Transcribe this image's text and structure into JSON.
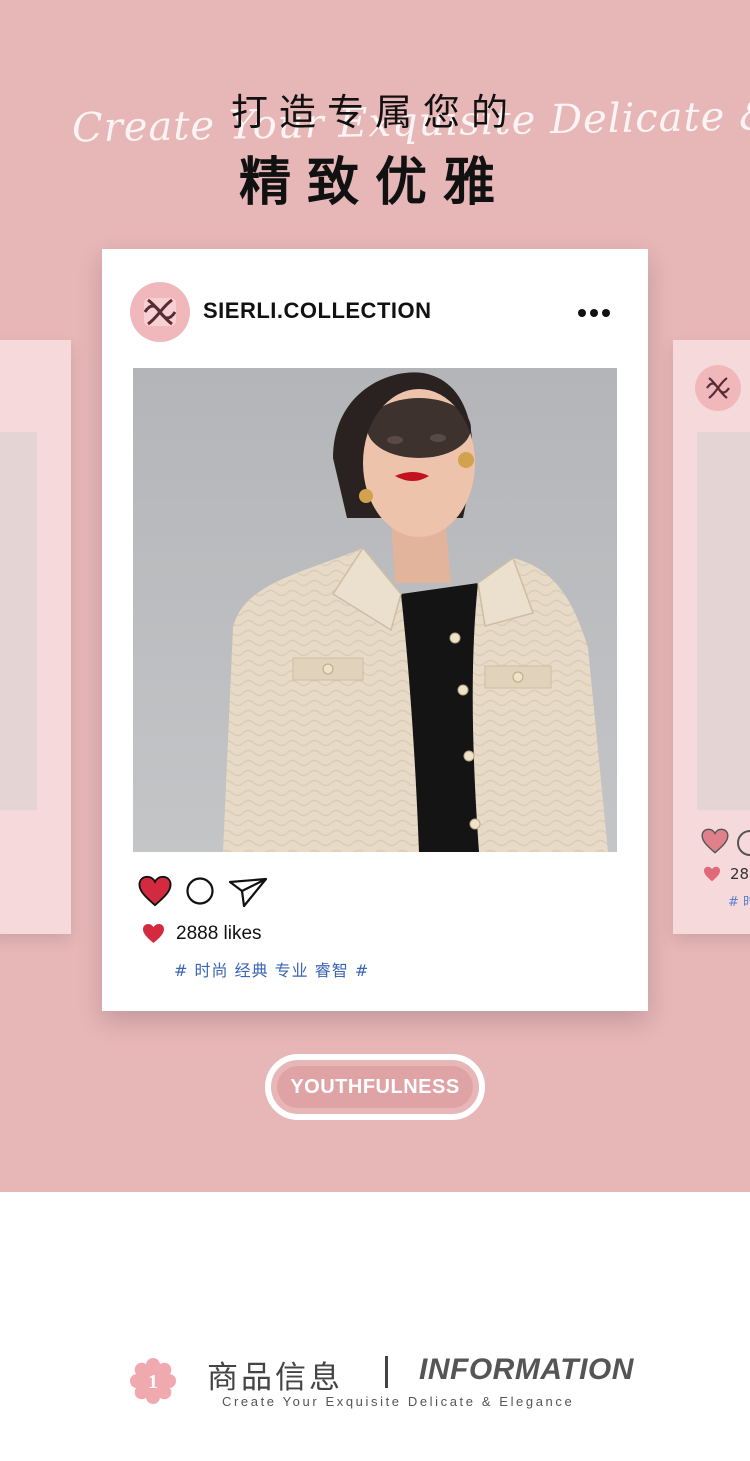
{
  "hero": {
    "script_text": "Create Your Exquisite Delicate & Elegance",
    "title_line1": "打造专属您的",
    "title_line2": "精致优雅"
  },
  "post": {
    "brand": "SIERLI.COLLECTION",
    "more_icon": "more-dots-icon",
    "likes": "2888 likes",
    "tags": "# 时尚 经典 专业 睿智 #",
    "icons": [
      "heart-icon",
      "comment-icon",
      "send-icon"
    ]
  },
  "side_card_right": {
    "likes_peek": "28",
    "tags_peek": "# 时"
  },
  "button": {
    "label": "YOUTHFULNESS"
  },
  "info_section": {
    "badge_number": "1",
    "title_cn": "商品信息",
    "title_en": "INFORMATION",
    "subtitle": "Create Your Exquisite Delicate & Elegance"
  },
  "colors": {
    "background_pink": "#e7b6b7",
    "card_white": "#ffffff",
    "heart_red": "#d42a40",
    "tag_blue": "#3a64b5",
    "avatar_pink": "#f1b8bc"
  }
}
